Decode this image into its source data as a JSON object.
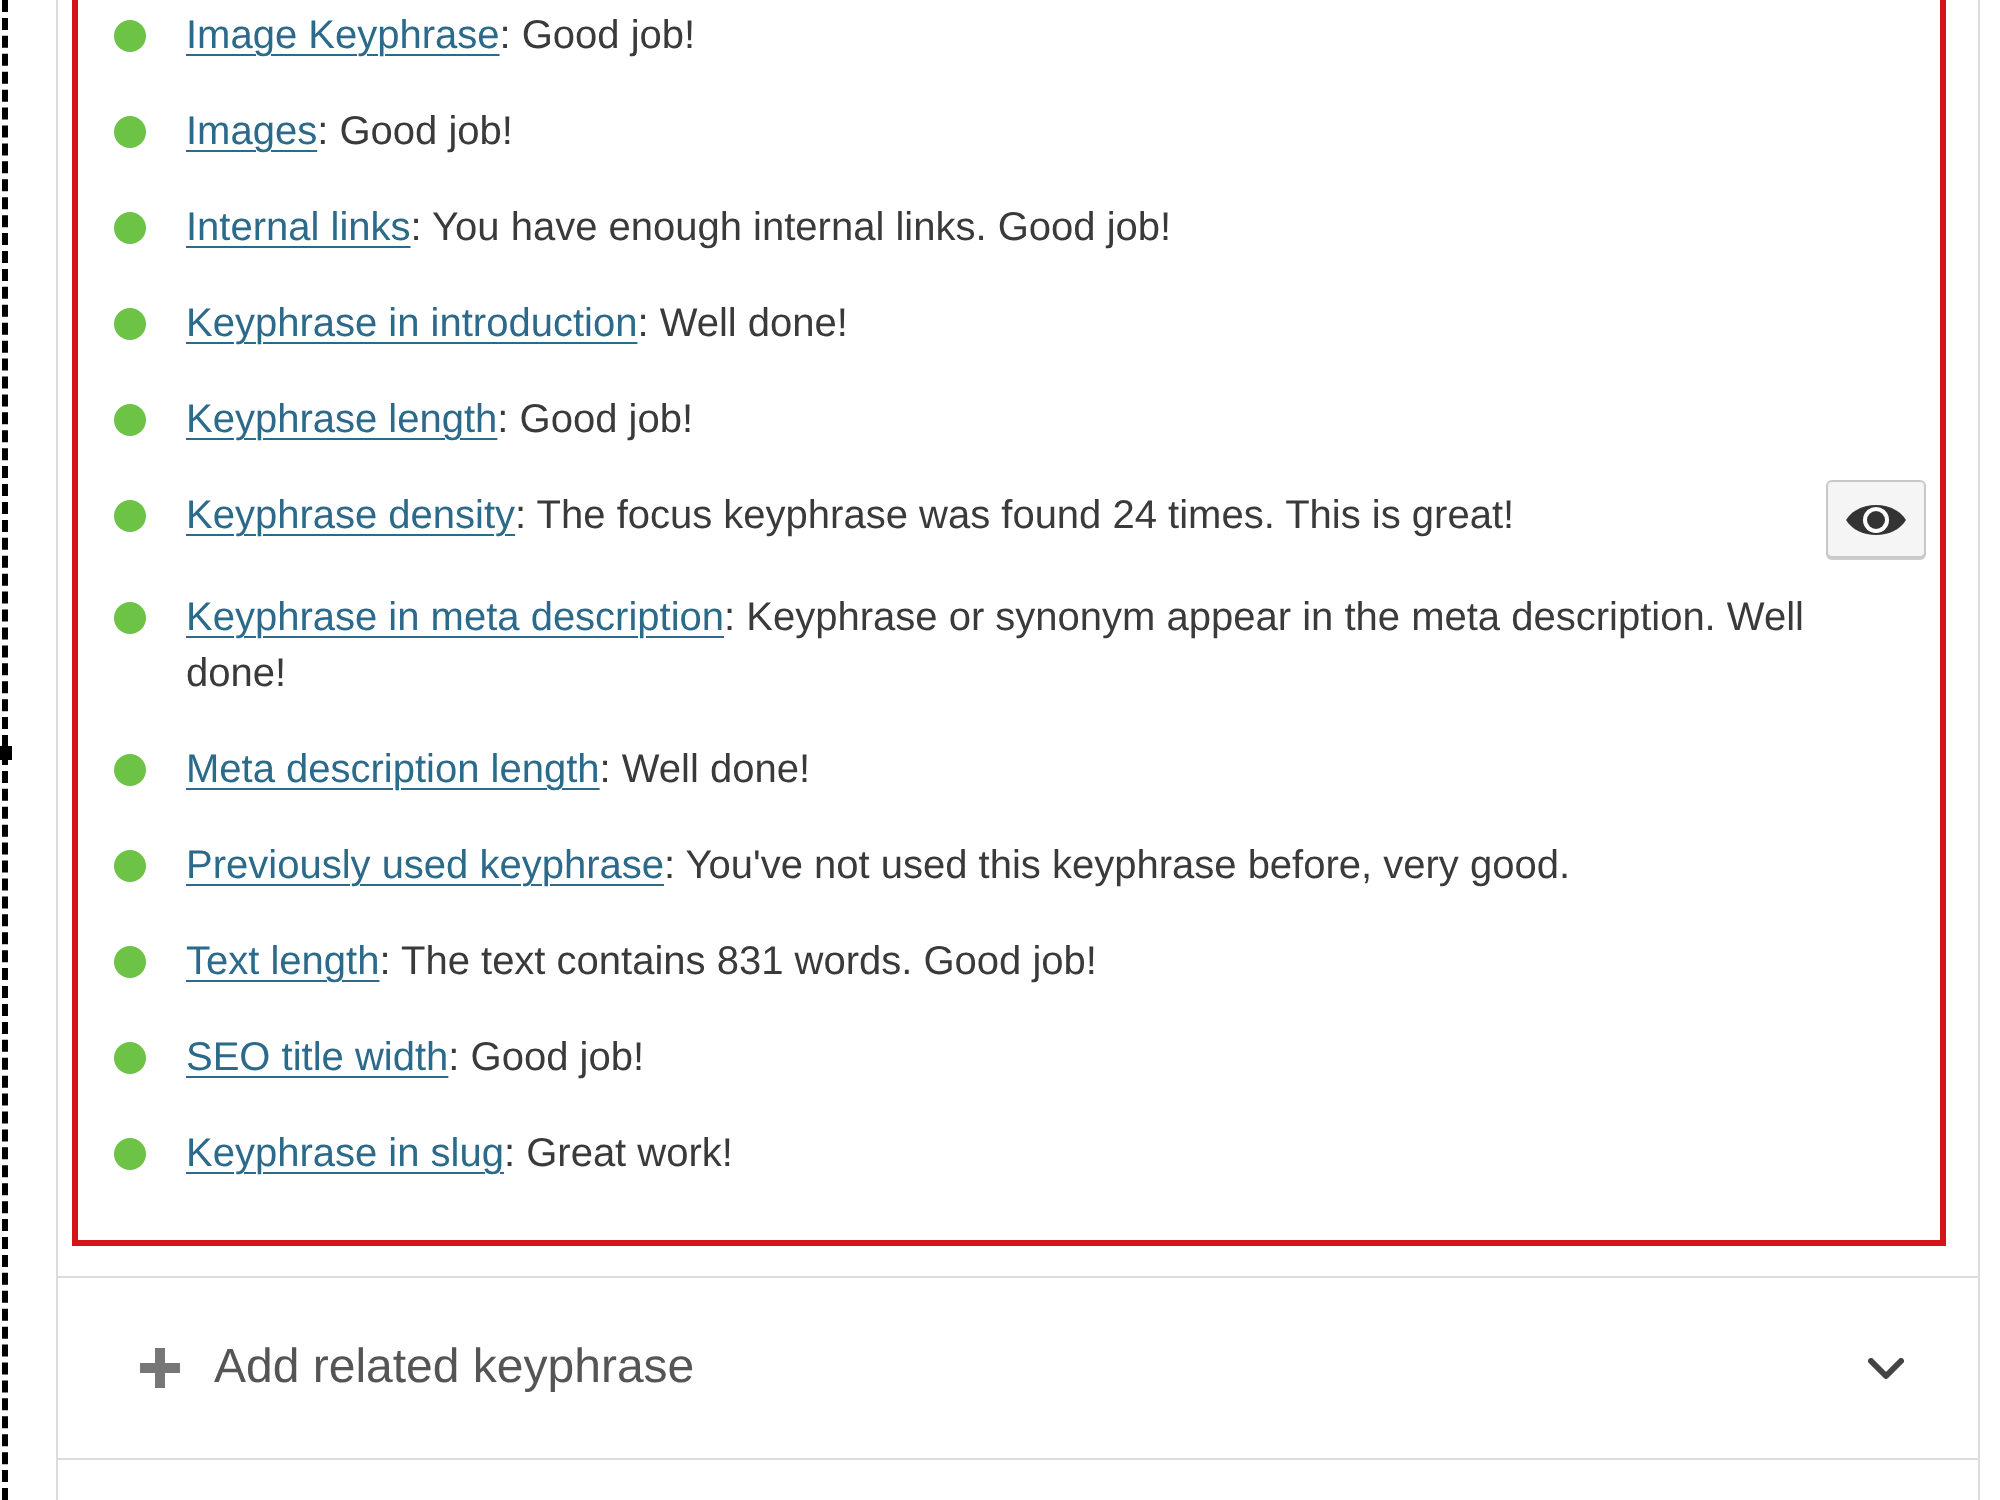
{
  "assessments": [
    {
      "color": "#6cc346",
      "link": "Image Keyphrase",
      "text": ": Good job!",
      "marker_button": false
    },
    {
      "color": "#6cc346",
      "link": "Images",
      "text": ": Good job!",
      "marker_button": false
    },
    {
      "color": "#6cc346",
      "link": "Internal links",
      "text": ": You have enough internal links. Good job!",
      "marker_button": false
    },
    {
      "color": "#6cc346",
      "link": "Keyphrase in introduction",
      "text": ": Well done!",
      "marker_button": false
    },
    {
      "color": "#6cc346",
      "link": "Keyphrase length",
      "text": ": Good job!",
      "marker_button": false
    },
    {
      "color": "#6cc346",
      "link": "Keyphrase density",
      "text": ": The focus keyphrase was found 24 times. This is great!",
      "marker_button": true
    },
    {
      "color": "#6cc346",
      "link": "Keyphrase in meta description",
      "text": ": Keyphrase or synonym appear in the meta description. Well done!",
      "marker_button": false
    },
    {
      "color": "#6cc346",
      "link": "Meta description length",
      "text": ": Well done!",
      "marker_button": false
    },
    {
      "color": "#6cc346",
      "link": "Previously used keyphrase",
      "text": ": You've not used this keyphrase before, very good.",
      "marker_button": false
    },
    {
      "color": "#6cc346",
      "link": "Text length",
      "text": ": The text contains 831 words. Good job!",
      "marker_button": false
    },
    {
      "color": "#6cc346",
      "link": "SEO title width",
      "text": ": Good job!",
      "marker_button": false
    },
    {
      "color": "#6cc346",
      "link": "Keyphrase in slug",
      "text": ": Great work!",
      "marker_button": false
    }
  ],
  "related_keyphrase": {
    "label": "Add related keyphrase",
    "expanded": false
  }
}
